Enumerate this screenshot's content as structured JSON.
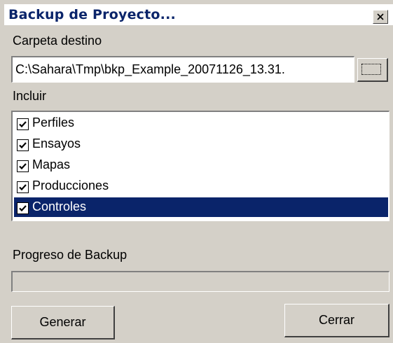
{
  "window": {
    "title": "Backup de Proyecto..."
  },
  "destination": {
    "label": "Carpeta destino",
    "path_value": "C:\\Sahara\\Tmp\\bkp_Example_20071126_13.31.",
    "browse_label": "..."
  },
  "include": {
    "label": "Incluir",
    "items": [
      {
        "label": "Perfiles",
        "checked": true,
        "selected": false
      },
      {
        "label": "Ensayos",
        "checked": true,
        "selected": false
      },
      {
        "label": "Mapas",
        "checked": true,
        "selected": false
      },
      {
        "label": "Producciones",
        "checked": true,
        "selected": false
      },
      {
        "label": "Controles",
        "checked": true,
        "selected": true
      }
    ]
  },
  "progress": {
    "label": "Progreso de Backup",
    "value_percent": 0
  },
  "buttons": {
    "generate_label": "Generar",
    "close_label": "Cerrar"
  },
  "colors": {
    "face": "#d4d0c8",
    "title_text": "#0a246a",
    "selection": "#0a246a"
  },
  "icons": {
    "close": "close-x-icon",
    "check": "checkmark-icon"
  }
}
